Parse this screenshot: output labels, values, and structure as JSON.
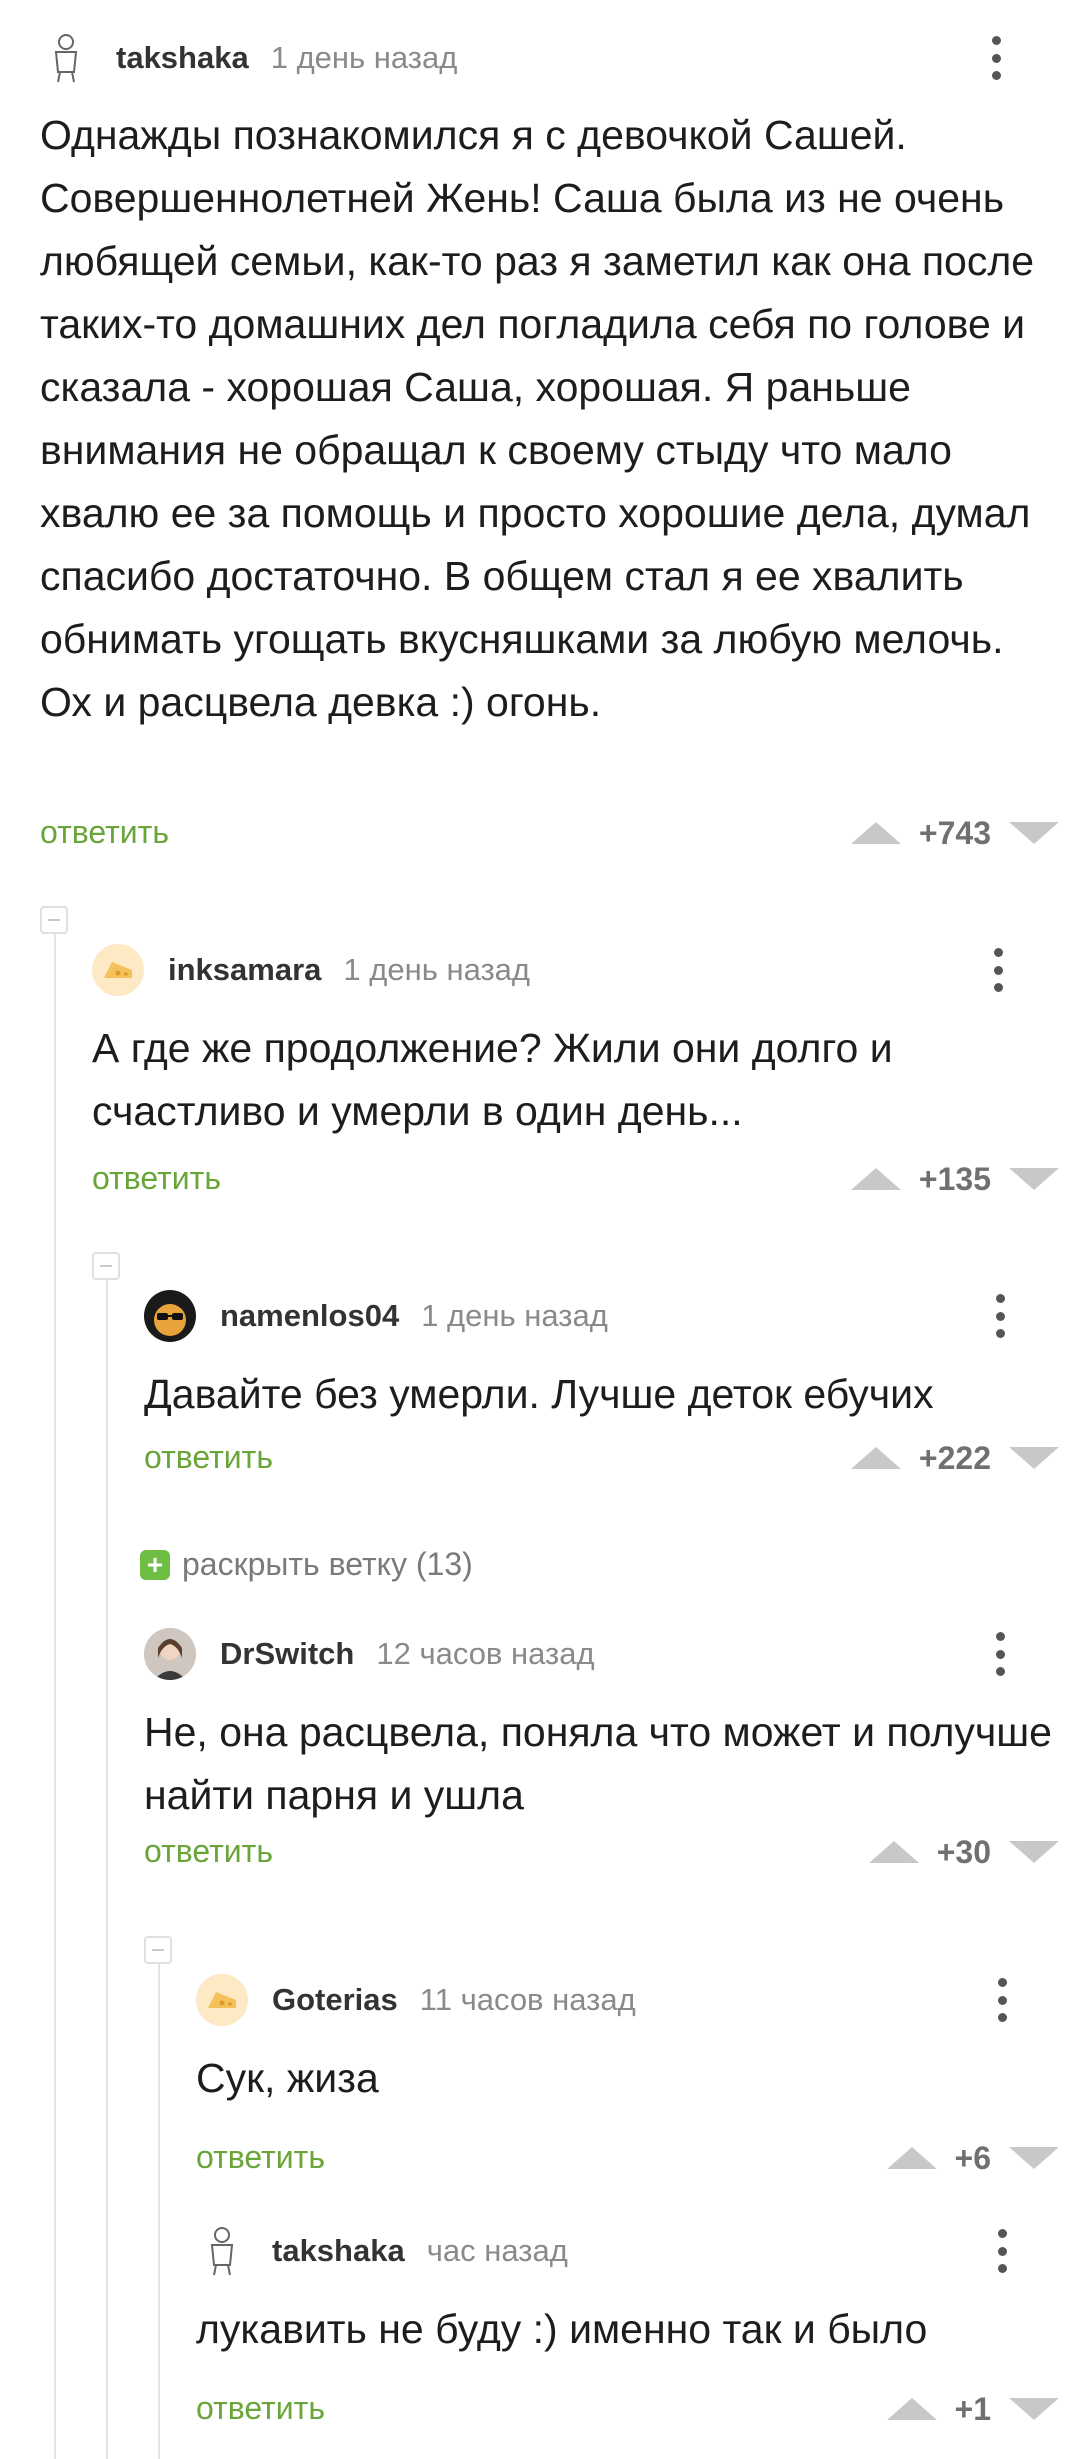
{
  "comments": [
    {
      "username": "takshaka",
      "time": "1 день назад",
      "avatar": "pirate-figure-avatar",
      "text": "Однажды познакомился я с девочкой Сашей. Совершеннолетней Жень! Саша была из не очень любящей семьи, как-то раз я заметил как она после таких-то домашних дел погладила себя по голове и сказала - хорошая Саша, хорошая. Я раньше внимания не обращал к своему стыду что мало хвалю ее за помощь и просто хорошие дела, думал спасибо достаточно. В общем стал я ее хвалить обнимать угощать вкусняшками за любую мелочь. Ох и расцвела девка :) огонь.",
      "reply": "ответить",
      "rating": "+743"
    },
    {
      "username": "inksamara",
      "time": "1 день назад",
      "avatar": "default-cheese-avatar",
      "text": "А где же продолжение? Жили они долго и счастливо и умерли в один день...",
      "reply": "ответить",
      "rating": "+135"
    },
    {
      "username": "namenlos04",
      "time": "1 день назад",
      "avatar": "sunglasses-avatar",
      "text": "Давайте без умерли. Лучше деток ебучих",
      "reply": "ответить",
      "rating": "+222"
    },
    {
      "username": "DrSwitch",
      "time": "12 часов назад",
      "avatar": "photo-avatar",
      "text": "Не, она расцвела, поняла что может и получше найти парня и ушла",
      "reply": "ответить",
      "rating": "+30"
    },
    {
      "username": "Goterias",
      "time": "11 часов назад",
      "avatar": "default-cheese-avatar",
      "text": "Сук, жиза",
      "reply": "ответить",
      "rating": "+6"
    },
    {
      "username": "takshaka",
      "time": "час назад",
      "avatar": "pirate-figure-avatar",
      "text": "лукавить не буду :) именно так и было",
      "reply": "ответить",
      "rating": "+1"
    }
  ],
  "expand_branch": {
    "icon": "plus-icon",
    "label": "раскрыть ветку (13)"
  },
  "colors": {
    "reply_green": "#6aa53a",
    "expand_green": "#6fbe44",
    "vote_grey": "#c8c8c8"
  }
}
